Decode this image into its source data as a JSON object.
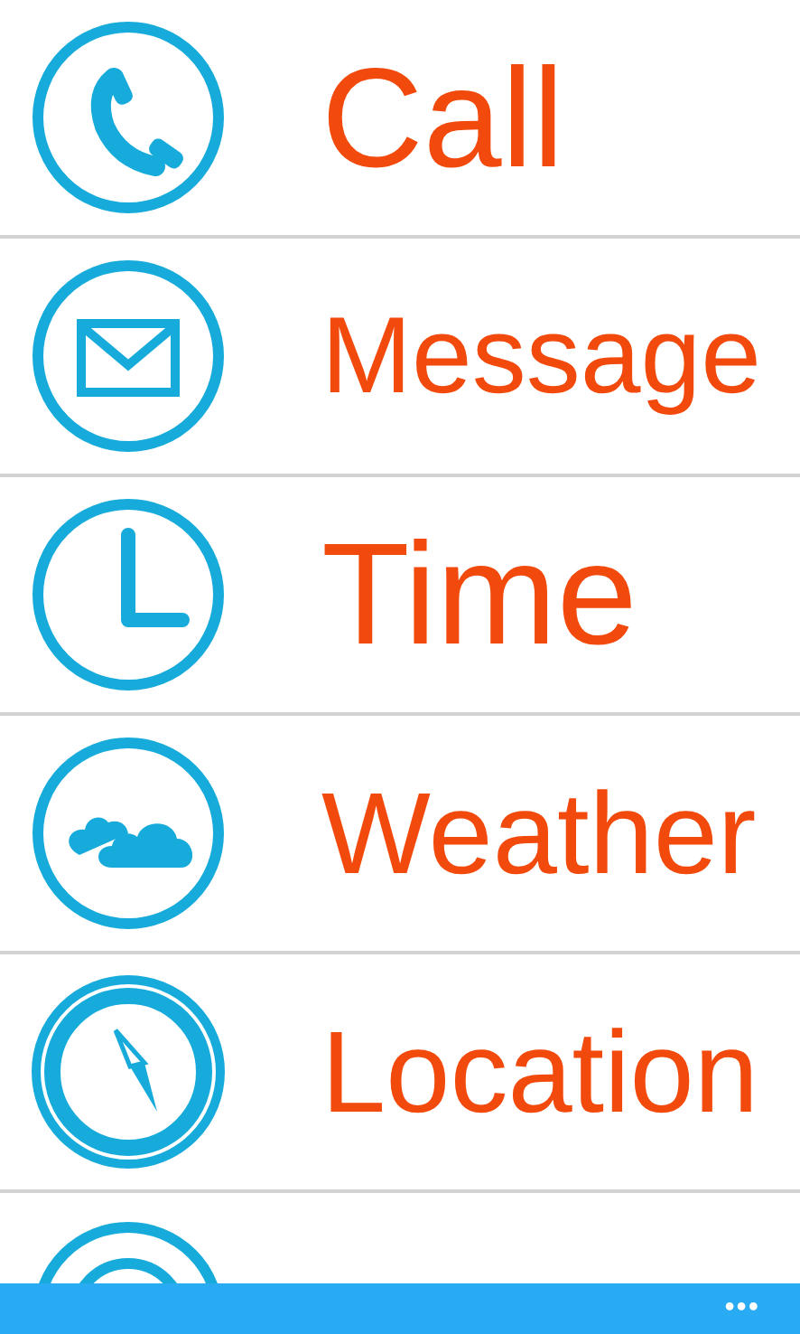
{
  "items": [
    {
      "kind": "phone",
      "label": "Call"
    },
    {
      "kind": "mail",
      "label": "Message"
    },
    {
      "kind": "clock",
      "label": "Time"
    },
    {
      "kind": "cloud",
      "label": "Weather"
    },
    {
      "kind": "compass",
      "label": "Location"
    },
    {
      "kind": "rings"
    }
  ],
  "app_bar": {
    "more": "•••"
  }
}
